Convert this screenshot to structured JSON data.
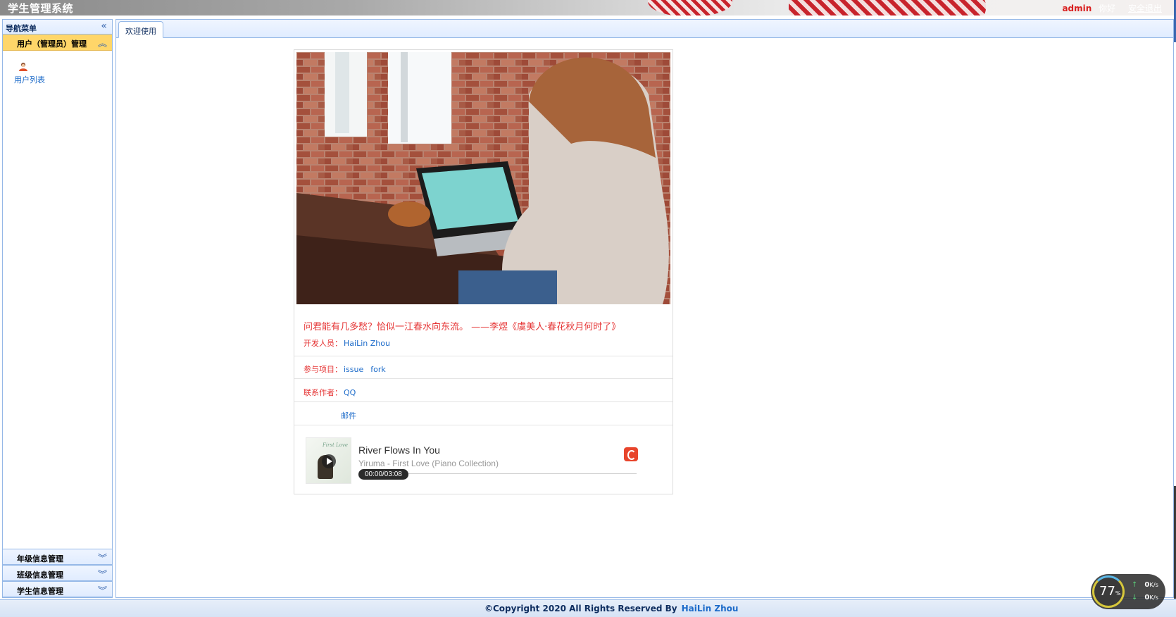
{
  "header": {
    "title": "学生管理系统",
    "username": "admin",
    "greeting": "你好",
    "logout": "安全退出"
  },
  "sidebar": {
    "title": "导航菜单",
    "active_group": "用户（管理员）管理",
    "active_items": [
      {
        "label": "用户列表",
        "icon": "user-icon"
      }
    ],
    "groups": [
      {
        "label": "年级信息管理"
      },
      {
        "label": "班级信息管理"
      },
      {
        "label": "学生信息管理"
      }
    ]
  },
  "tabs": [
    {
      "label": "欢迎使用"
    }
  ],
  "welcome": {
    "quote": "问君能有几多愁？恰似一江春水向东流。 ——李煜《虞美人·春花秋月何时了》",
    "developer_label": "开发人员：",
    "developer_name": "HaiLin Zhou",
    "project_label": "参与项目：",
    "project_links": [
      "issue",
      "fork"
    ],
    "contact_label": "联系作者：",
    "contact_qq": "QQ",
    "contact_mail": "邮件"
  },
  "player": {
    "song": "River Flows In You",
    "artist": "Yiruma - First Love (Piano Collection)",
    "time": "00:00/03:08",
    "cover_script": "First Love",
    "progress": 0
  },
  "footer": {
    "copyright": "©Copyright  2020 All Rights Reserved By",
    "author": "HaiLin Zhou"
  },
  "speed_widget": {
    "percent": "77",
    "percent_unit": "%",
    "up": "0",
    "down": "0",
    "unit": "K/s"
  },
  "colors": {
    "accent": "#95b8e7",
    "active_menu": "#ffd669",
    "quote": "#e53333",
    "link": "#1b6ac9"
  }
}
